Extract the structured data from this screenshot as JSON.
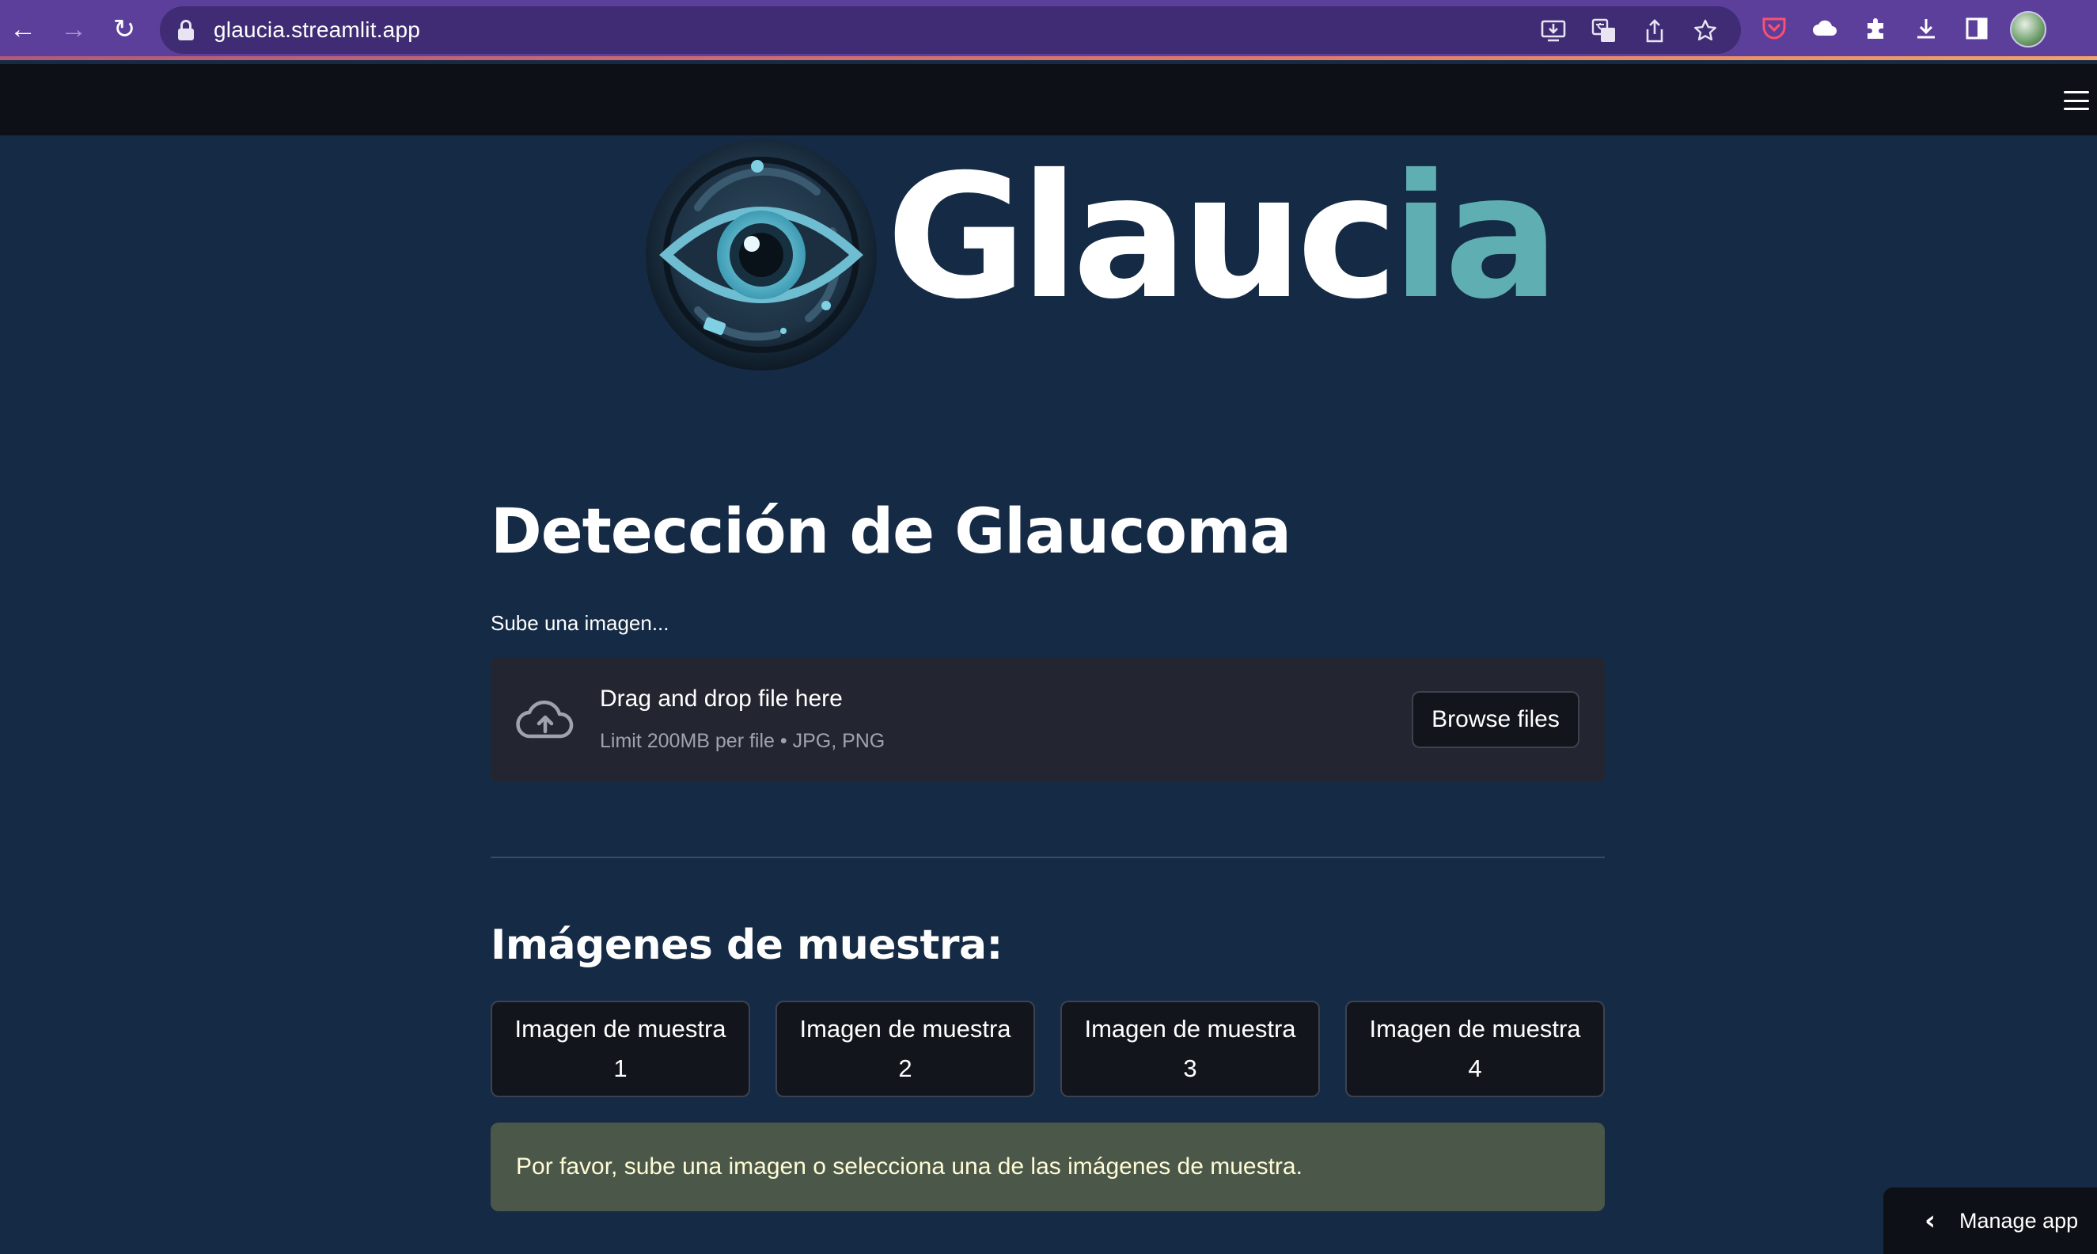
{
  "browser": {
    "url": "glaucia.streamlit.app",
    "nav_back": "←",
    "nav_forward": "→",
    "reload": "↻"
  },
  "logo": {
    "word_main": "Glauc",
    "word_accent": "ia",
    "accent_color": "#5faeb2"
  },
  "main": {
    "title": "Detección de Glaucoma",
    "upload_label": "Sube una imagen...",
    "dropzone": {
      "title": "Drag and drop file here",
      "subtitle": "Limit 200MB per file • JPG, PNG",
      "browse_label": "Browse files"
    },
    "samples_title": "Imágenes de muestra:",
    "samples": [
      {
        "line1": "Imagen de muestra",
        "line2": "1"
      },
      {
        "line1": "Imagen de muestra",
        "line2": "2"
      },
      {
        "line1": "Imagen de muestra",
        "line2": "3"
      },
      {
        "line1": "Imagen de muestra",
        "line2": "4"
      }
    ],
    "alert": "Por favor, sube una imagen o selecciona una de las imágenes de muestra."
  },
  "manage_app": {
    "label": "Manage app"
  },
  "colors": {
    "page_bg": "#152a45",
    "browser_bar": "#5b3f9a",
    "header_bg": "#0d1016",
    "alert_bg": "#4b5749",
    "alert_text": "#fffbd6"
  }
}
